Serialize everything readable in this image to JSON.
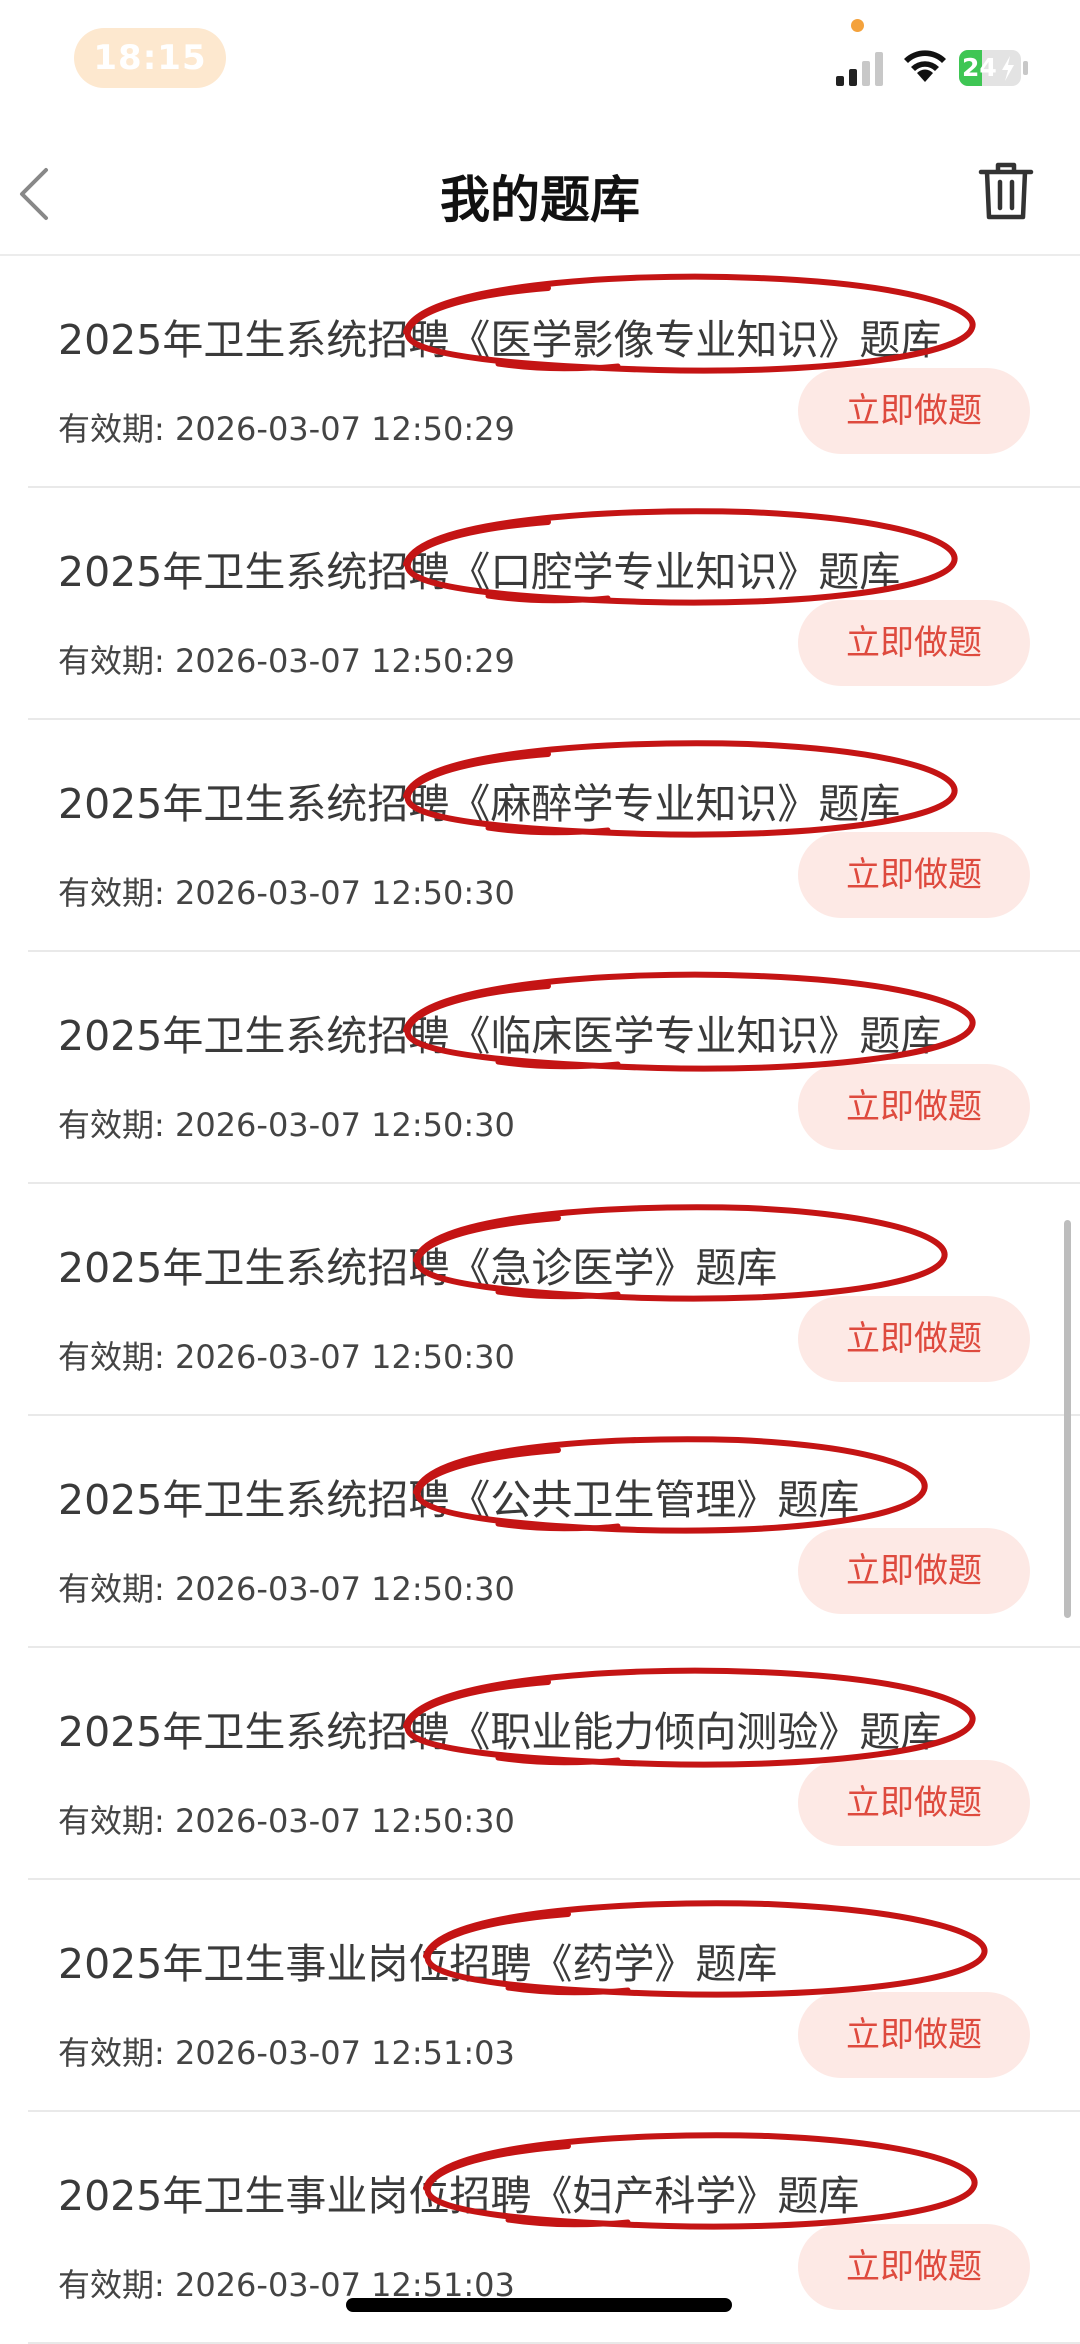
{
  "status_bar": {
    "time": "18:15",
    "battery": "24"
  },
  "nav": {
    "title": "我的题库"
  },
  "items": [
    {
      "title": "2025年卫生系统招聘《医学影像专业知识》题库",
      "validity": "有效期: 2026-03-07 12:50:29",
      "button": "立即做题"
    },
    {
      "title": "2025年卫生系统招聘《口腔学专业知识》题库",
      "validity": "有效期: 2026-03-07 12:50:29",
      "button": "立即做题"
    },
    {
      "title": "2025年卫生系统招聘《麻醉学专业知识》题库",
      "validity": "有效期: 2026-03-07 12:50:30",
      "button": "立即做题"
    },
    {
      "title": "2025年卫生系统招聘《临床医学专业知识》题库",
      "validity": "有效期: 2026-03-07 12:50:30",
      "button": "立即做题"
    },
    {
      "title": "2025年卫生系统招聘《急诊医学》题库",
      "validity": "有效期: 2026-03-07 12:50:30",
      "button": "立即做题"
    },
    {
      "title": "2025年卫生系统招聘《公共卫生管理》题库",
      "validity": "有效期: 2026-03-07 12:50:30",
      "button": "立即做题"
    },
    {
      "title": "2025年卫生系统招聘《职业能力倾向测验》题库",
      "validity": "有效期: 2026-03-07 12:50:30",
      "button": "立即做题"
    },
    {
      "title": "2025年卫生事业岗位招聘《药学》题库",
      "validity": "有效期: 2026-03-07 12:51:03",
      "button": "立即做题"
    },
    {
      "title": "2025年卫生事业岗位招聘《妇产科学》题库",
      "validity": "有效期: 2026-03-07 12:51:03",
      "button": "立即做题"
    }
  ],
  "colors": {
    "accent": "#de4a3e",
    "button_bg": "#fde9e5",
    "annotation": "#c41414"
  }
}
